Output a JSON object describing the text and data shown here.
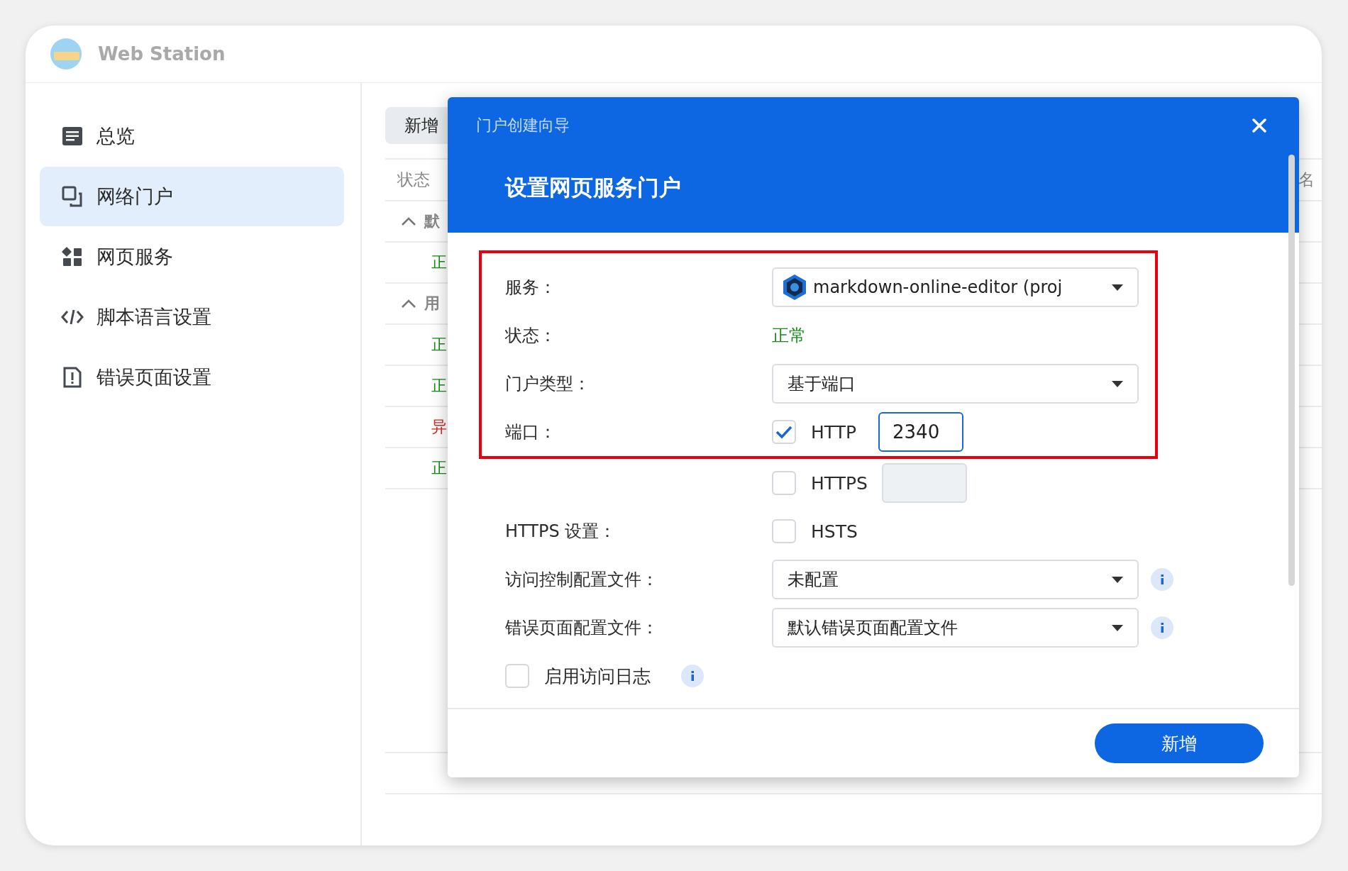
{
  "app": {
    "title": "Web Station"
  },
  "sidebar": {
    "items": [
      {
        "label": "总览",
        "selected": false
      },
      {
        "label": "网络门户",
        "selected": true
      },
      {
        "label": "网页服务",
        "selected": false
      },
      {
        "label": "脚本语言设置",
        "selected": false
      },
      {
        "label": "错误页面设置",
        "selected": false
      }
    ]
  },
  "content": {
    "add_button": "新增",
    "table": {
      "columns": [
        "状态",
        "名"
      ],
      "groups": [
        {
          "label": "默",
          "expanded": true,
          "rows": [
            {
              "status": "正",
              "color": "#1a8a1a"
            }
          ]
        },
        {
          "label": "用",
          "expanded": true,
          "rows": [
            {
              "status": "正",
              "color": "#1a8a1a"
            },
            {
              "status": "正",
              "color": "#1a8a1a"
            },
            {
              "status": "异",
              "color": "#d42a2a"
            },
            {
              "status": "正",
              "color": "#1a8a1a"
            }
          ]
        }
      ]
    }
  },
  "dialog": {
    "title": "门户创建向导",
    "heading": "设置网页服务门户",
    "highlighted_fields": [
      {
        "kind": "select",
        "label": "服务：",
        "value": "markdown-online-editor (proj",
        "service_icon": true
      },
      {
        "kind": "status",
        "label": "状态：",
        "value": "正常"
      },
      {
        "kind": "select",
        "label": "门户类型：",
        "value": "基于端口"
      },
      {
        "kind": "port",
        "label": "端口：",
        "option": "HTTP",
        "checked": true,
        "value": "2340",
        "disabled": false
      }
    ],
    "fields": [
      {
        "kind": "port",
        "option": "HTTPS",
        "checked": false,
        "disabled": true
      },
      {
        "kind": "check",
        "label": "HTTPS 设置：",
        "option": "HSTS",
        "checked": false
      },
      {
        "kind": "select",
        "label": "访问控制配置文件：",
        "value": "未配置",
        "info": true
      },
      {
        "kind": "select",
        "label": "错误页面配置文件：",
        "value": "默认错误页面配置文件",
        "info": true
      },
      {
        "kind": "wide_check",
        "option": "启用访问日志",
        "checked": false,
        "info": true
      }
    ],
    "primary_button": "新增"
  }
}
